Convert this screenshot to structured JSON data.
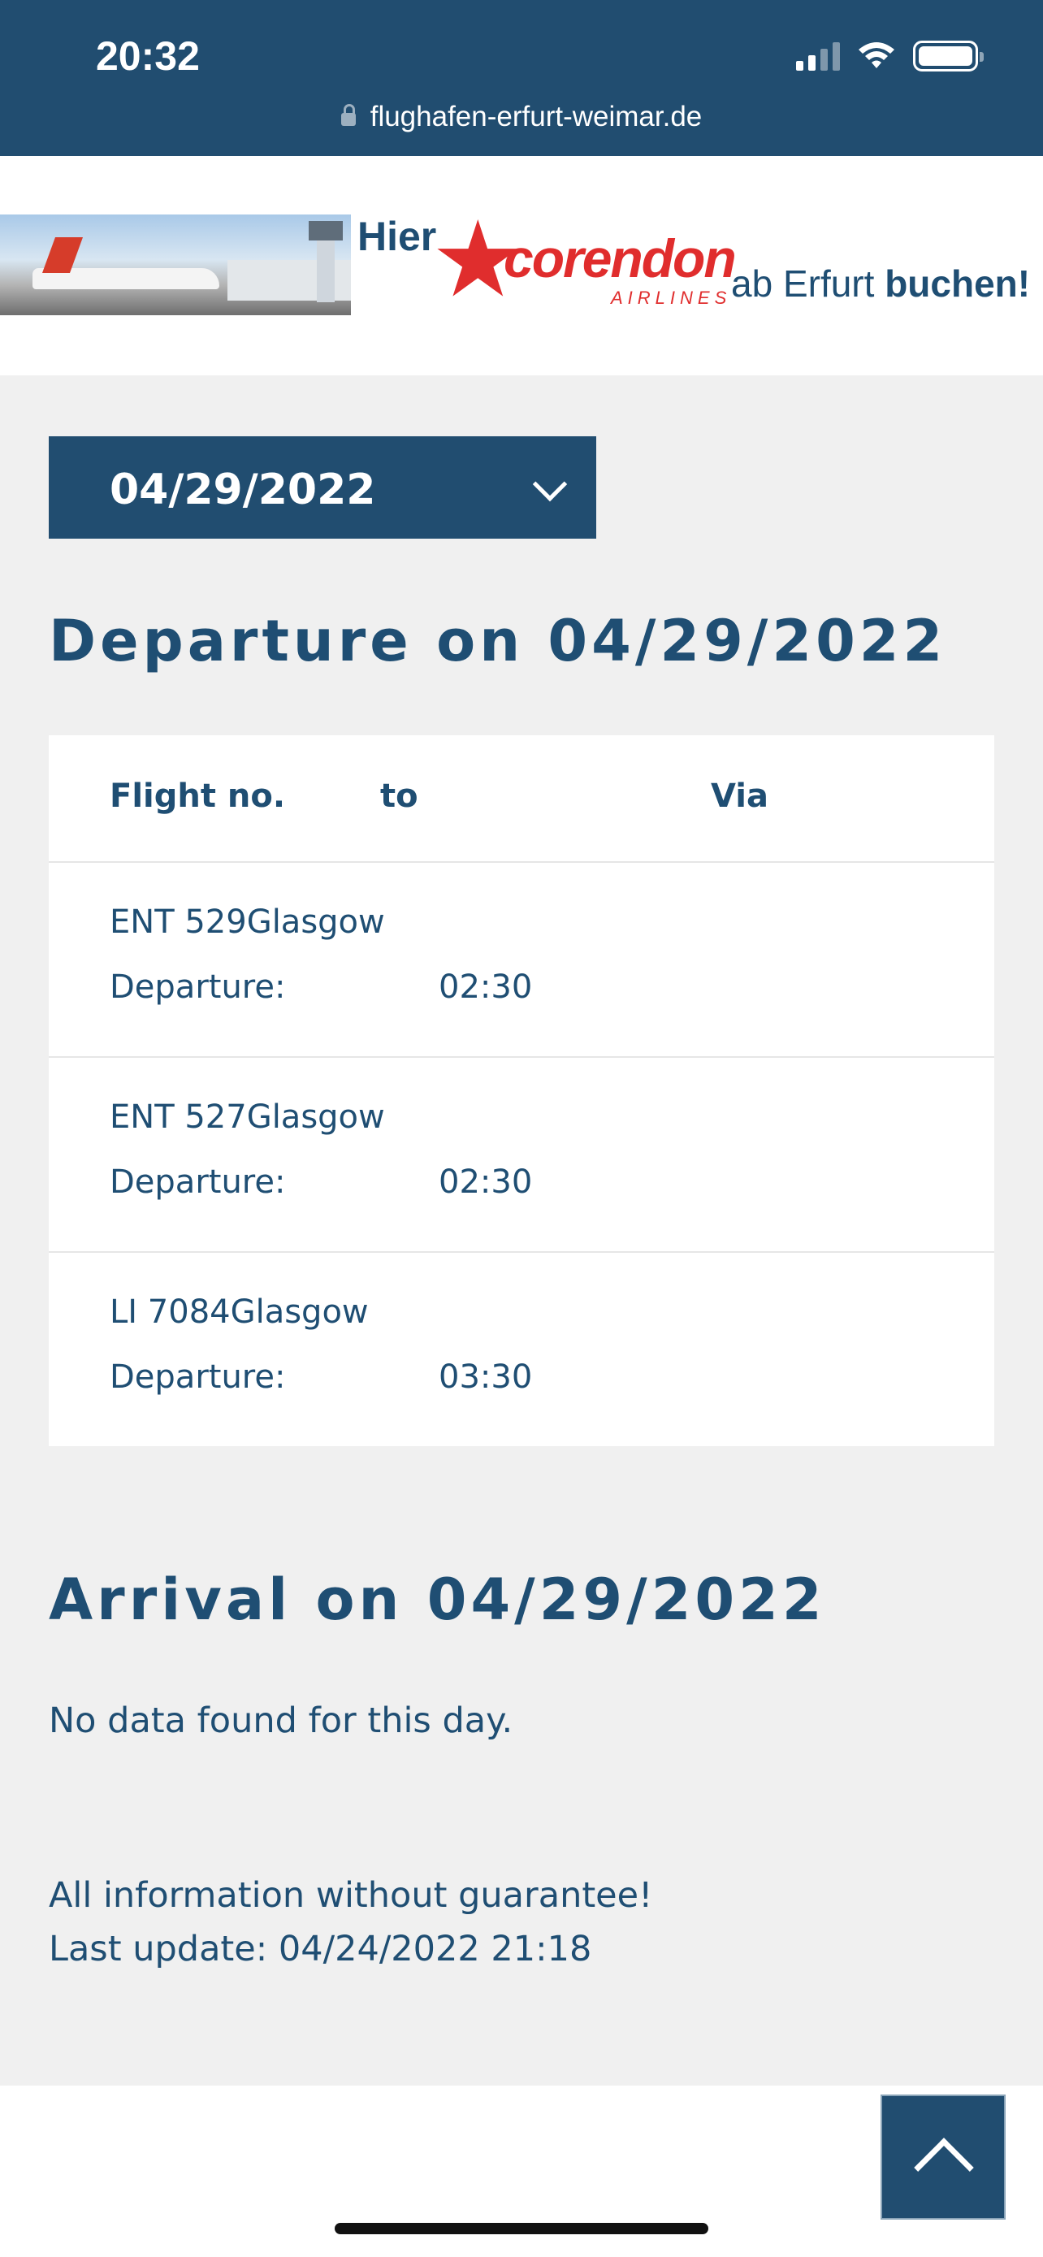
{
  "status_bar": {
    "time": "20:32",
    "url": "flughafen-erfurt-weimar.de"
  },
  "banner": {
    "hier": "Hier",
    "brand": "corendon",
    "airlines": "AIRLINES",
    "rest_plain": "ab Erfurt ",
    "rest_bold": "buchen!"
  },
  "date_select": {
    "value": "04/29/2022",
    "icon": "chevron-down-icon"
  },
  "departures": {
    "heading": "Departure on 04/29/2022",
    "columns": [
      "Flight no.",
      "to",
      "Via"
    ],
    "rows": [
      {
        "flight": "ENT 529Glasgow",
        "departure_label": "Departure:",
        "time": "02:30"
      },
      {
        "flight": "ENT 527Glasgow",
        "departure_label": "Departure:",
        "time": "02:30"
      },
      {
        "flight": "LI 7084Glasgow",
        "departure_label": "Departure:",
        "time": "03:30"
      }
    ]
  },
  "arrivals": {
    "heading": "Arrival on 04/29/2022",
    "empty_message": "No data found for this day."
  },
  "notes": {
    "disclaimer": "All information without guarantee!",
    "last_update": "Last update: 04/24/2022 21:18"
  },
  "scroll_top": {
    "icon": "chevron-up-icon"
  },
  "colors": {
    "primary": "#214d70",
    "text": "#1f4e73",
    "page_bg": "#f0f0f0",
    "brand_red": "#e02d2d"
  }
}
